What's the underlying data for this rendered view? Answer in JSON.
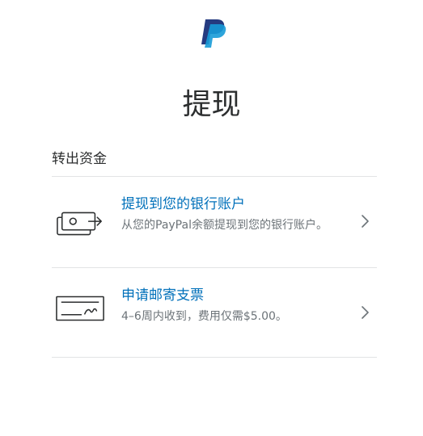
{
  "header": {
    "logo": "paypal-logo-icon",
    "title": "提现"
  },
  "section": {
    "title": "转出资金"
  },
  "options": [
    {
      "icon": "bank-transfer-icon",
      "title": "提现到您的银行账户",
      "description": "从您的PayPal余额提现到您的银行账户。"
    },
    {
      "icon": "check-icon",
      "title": "申请邮寄支票",
      "description": "4–6周内收到，费用仅需$5.00。"
    }
  ],
  "colors": {
    "paypal_dark_blue": "#253b80",
    "paypal_light_blue": "#179bd7",
    "link_blue": "#0070ba",
    "text_gray": "#6c7378",
    "divider": "#e2e3e5"
  }
}
